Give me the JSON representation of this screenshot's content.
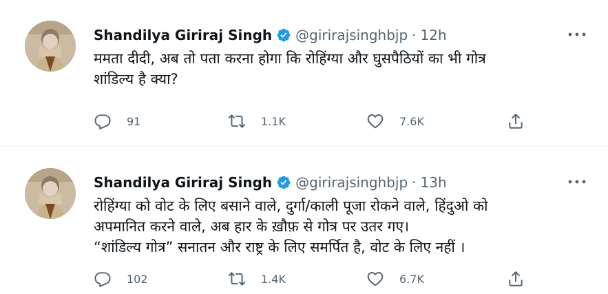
{
  "tweets": [
    {
      "author_name": "Shandilya Giriraj Singh",
      "handle": "@girirajsinghbjp",
      "separator": "·",
      "time": "12h",
      "text_lines": [
        "ममता दीदी, अब तो पता करना होगा कि रोहिंग्या और घुसपैठियों का भी गोत्र",
        "शांडिल्य है क्या?"
      ],
      "replies": "91",
      "retweets": "1.1K",
      "likes": "7.6K"
    },
    {
      "author_name": "Shandilya Giriraj Singh",
      "handle": "@girirajsinghbjp",
      "separator": "·",
      "time": "13h",
      "text_lines": [
        "रोहिंग्या को वोट के लिए बसाने वाले, दुर्गा/काली पूजा रोकने वाले, हिंदुओ को",
        "अपमानित करने वाले, अब हार के ख़ौफ़ से गोत्र पर उतर गए।",
        "“शांडिल्य गोत्र” सनातन और राष्ट्र के लिए समर्पित है, वोट के लिए नहीं ।"
      ],
      "replies": "102",
      "retweets": "1.4K",
      "likes": "6.7K"
    }
  ],
  "icons": {
    "verified": "verified-badge-icon",
    "more": "more-options-icon",
    "reply": "reply-icon",
    "retweet": "retweet-icon",
    "like": "like-heart-icon",
    "share": "share-icon"
  },
  "colors": {
    "verified_blue": "#1d9bf0",
    "secondary_text": "#536471",
    "primary_text": "#0f1419",
    "divider": "#eff3f4"
  }
}
